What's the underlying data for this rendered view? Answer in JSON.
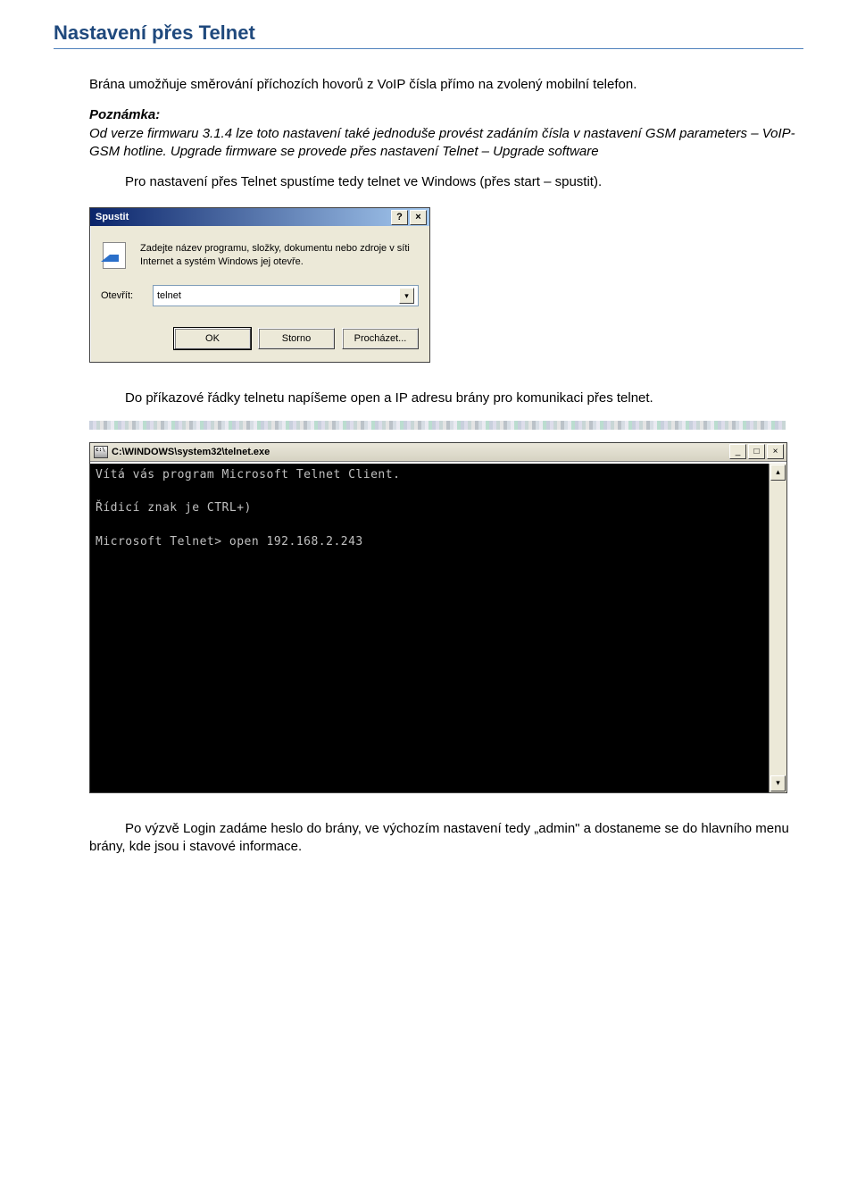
{
  "heading": "Nastavení přes Telnet",
  "intro": "Brána umožňuje směrování příchozích hovorů z VoIP čísla přímo na zvolený mobilní telefon.",
  "note_label": "Poznámka:",
  "note_body": "Od verze firmwaru 3.1.4 lze toto nastavení také jednoduše provést zadáním čísla v nastavení GSM parameters – VoIP-GSM hotline. Upgrade firmware se provede přes nastavení Telnet – Upgrade software",
  "para_start": "Pro nastavení přes Telnet spustíme tedy telnet ve Windows (přes start – spustit).",
  "run": {
    "title": "Spustit",
    "desc": "Zadejte název programu, složky, dokumentu nebo zdroje v síti Internet a systém Windows jej otevře.",
    "open_label": "Otevřít:",
    "value": "telnet",
    "btn_ok": "OK",
    "btn_cancel": "Storno",
    "btn_browse": "Procházet..."
  },
  "para_cmd": "Do příkazové řádky telnetu napíšeme open a IP adresu brány pro komunikaci přes telnet.",
  "console": {
    "title": "C:\\WINDOWS\\system32\\telnet.exe",
    "lines": [
      "Vítá vás program Microsoft Telnet Client.",
      "",
      "Řídicí znak je CTRL+)",
      "",
      "Microsoft Telnet> open 192.168.2.243"
    ]
  },
  "para_login": "Po výzvě Login zadáme heslo do brány, ve výchozím nastavení tedy „admin\" a dostaneme se do hlavního menu brány, kde jsou i stavové informace."
}
